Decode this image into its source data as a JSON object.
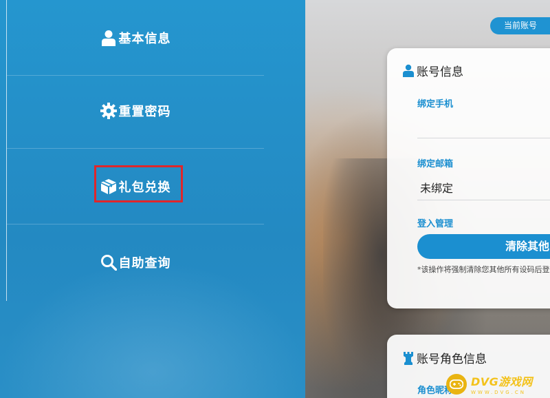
{
  "sidebar": {
    "items": [
      {
        "label": "基本信息",
        "icon": "user-icon"
      },
      {
        "label": "重置密码",
        "icon": "gear-icon"
      },
      {
        "label": "礼包兑换",
        "icon": "gift-box-icon",
        "highlighted": true
      },
      {
        "label": "自助查询",
        "icon": "search-icon"
      }
    ]
  },
  "header": {
    "account_pill": "当前账号"
  },
  "account_card": {
    "title": "账号信息",
    "title_icon": "user-icon",
    "phone_label": "绑定手机",
    "phone_value": "",
    "email_label": "绑定邮箱",
    "email_value": "未绑定",
    "login_label": "登入管理",
    "clear_button": "清除其他",
    "note": "*该操作将强制清除您其他所有设码后登入"
  },
  "role_card": {
    "title": "账号角色信息",
    "title_icon": "rook-icon",
    "nickname_label": "角色昵称"
  },
  "watermark": {
    "text": "DVG游戏网",
    "sub": "WWW.DVG.CN"
  },
  "colors": {
    "sidebar": "#2596cf",
    "accent": "#1b8fd0",
    "highlight_border": "#e0262a",
    "watermark": "#f3c21c"
  }
}
